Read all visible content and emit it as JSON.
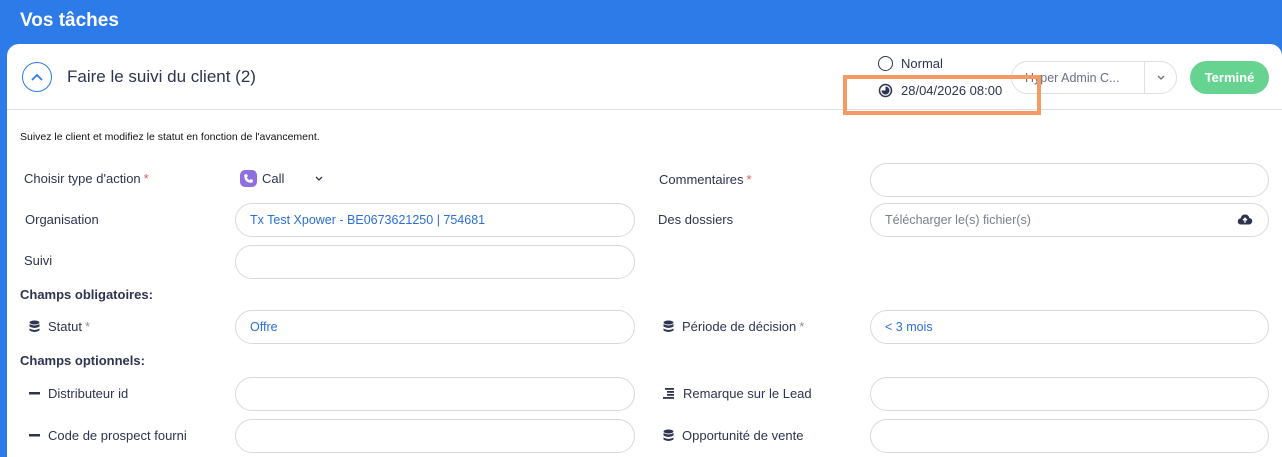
{
  "header": {
    "title": "Vos tâches"
  },
  "task": {
    "title": "Faire le suivi du client (2)",
    "priority": "Normal",
    "due_date": "28/04/2026 08:00",
    "assignee": "Hyper Admin C...",
    "done_label": "Terminé",
    "description": "Suivez le client et modifiez le statut en fonction de l'avancement."
  },
  "form": {
    "action_type_label": "Choisir type d'action",
    "action_type_value": "Call",
    "comments_label": "Commentaires",
    "comments_value": "",
    "organisation_label": "Organisation",
    "organisation_value": "Tx Test Xpower - BE0673621250 | 754681",
    "files_label": "Des dossiers",
    "files_placeholder": "Télécharger le(s) fichier(s)",
    "followup_label": "Suivi",
    "followup_value": "",
    "required_section": "Champs obligatoires:",
    "status_label": "Statut",
    "status_value": "Offre",
    "decision_label": "Période de décision",
    "decision_value": "< 3 mois",
    "optional_section": "Champs optionnels:",
    "distributor_label": "Distributeur id",
    "distributor_value": "",
    "lead_note_label": "Remarque sur le Lead",
    "lead_note_value": "",
    "prospect_code_label": "Code de prospect fourni",
    "prospect_code_value": "",
    "opportunity_label": "Opportunité de vente",
    "opportunity_value": "",
    "required_marker": "*"
  },
  "colors": {
    "primary": "#2d7be8",
    "success": "#67d391",
    "highlight": "#f59a63",
    "required": "#e05a5a"
  }
}
